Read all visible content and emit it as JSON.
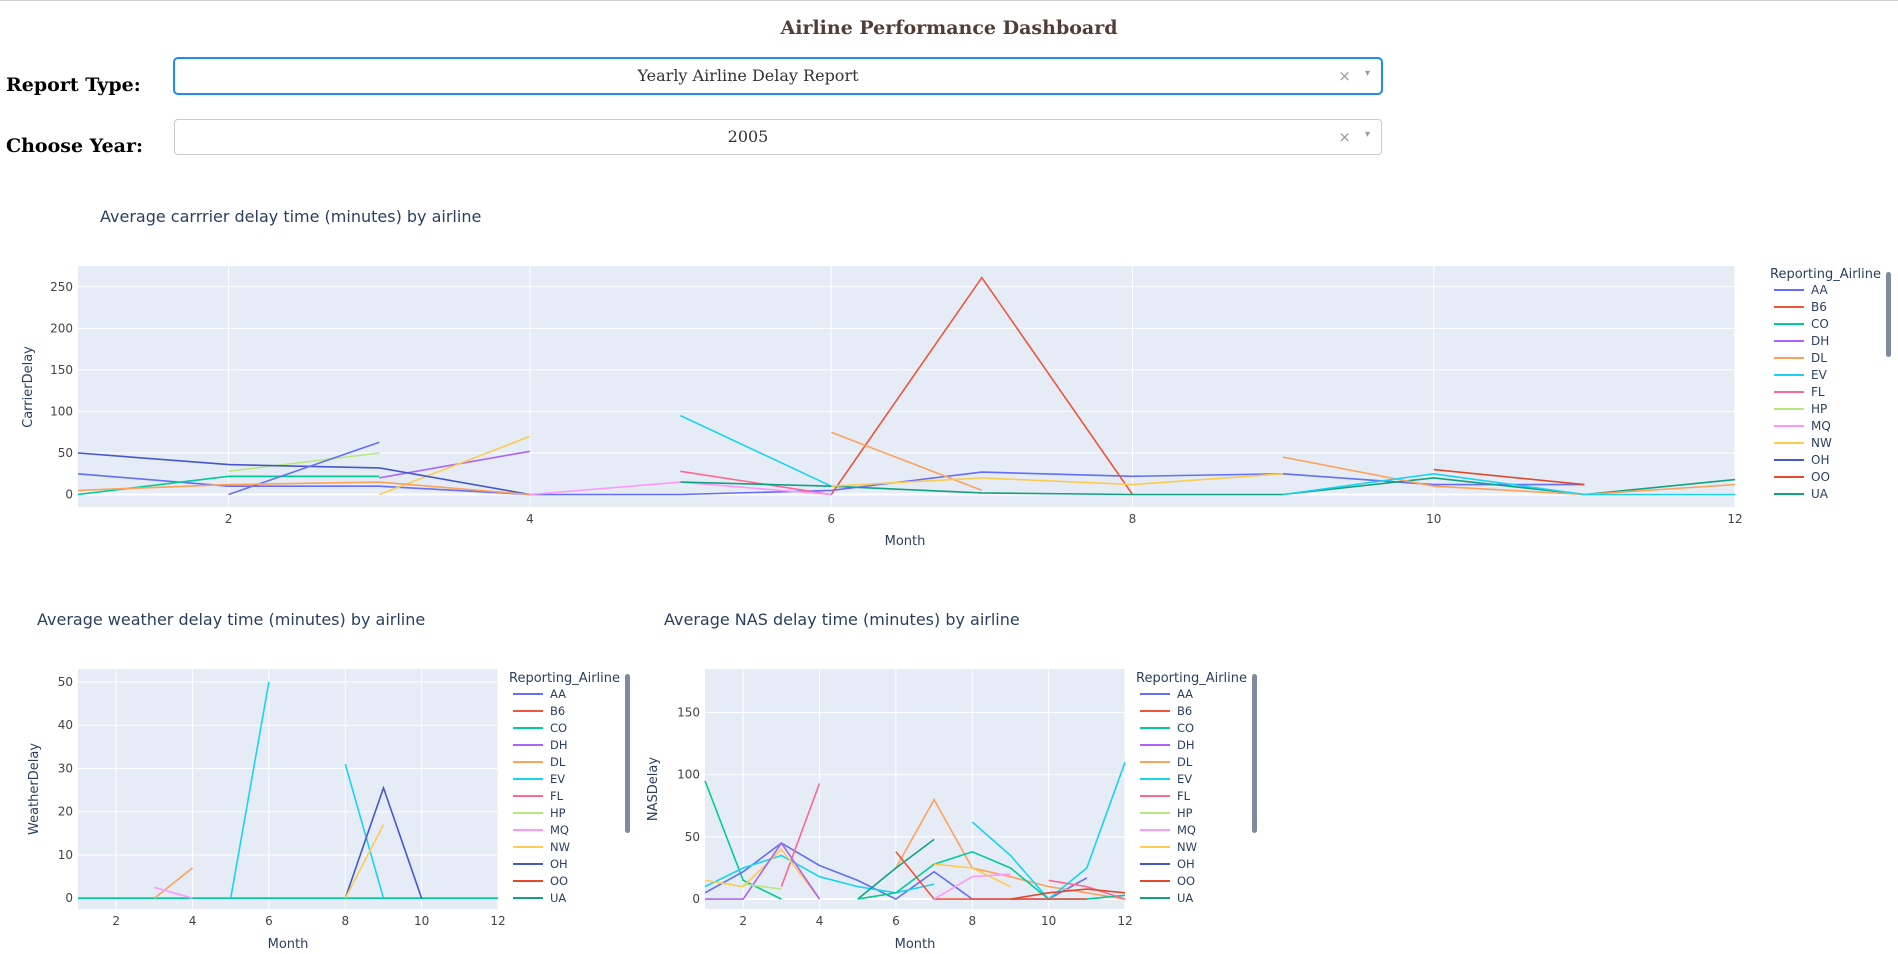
{
  "page_title": "Airline Performance Dashboard",
  "controls": {
    "report_type": {
      "label": "Report Type:",
      "value": "Yearly Airline Delay Report",
      "clear_icon": "×",
      "arrow_icon": "▾"
    },
    "year": {
      "label": "Choose Year:",
      "value": "2005",
      "clear_icon": "×",
      "arrow_icon": "▾"
    }
  },
  "legend_title": "Reporting_Airline",
  "airlines": [
    "AA",
    "B6",
    "CO",
    "DH",
    "DL",
    "EV",
    "FL",
    "HP",
    "MQ",
    "NW",
    "OH",
    "OO",
    "UA"
  ],
  "colors": {
    "AA": "#636efa",
    "B6": "#ef553b",
    "CO": "#00cc96",
    "DH": "#ab63fa",
    "DL": "#ffa15a",
    "EV": "#19d3f3",
    "FL": "#ff6692",
    "HP": "#b6e880",
    "MQ": "#ff97ff",
    "NW": "#fecb52",
    "OH": "#4458cc",
    "OO": "#e04a2a",
    "UA": "#10a37f"
  },
  "chart_data": [
    {
      "type": "line",
      "title": "Average carrrier delay time (minutes) by airline",
      "xlabel": "Month",
      "ylabel": "CarrierDelay",
      "xlim": [
        1,
        12
      ],
      "ylim": [
        -15,
        275
      ],
      "x_ticks": [
        2,
        4,
        6,
        8,
        10,
        12
      ],
      "y_ticks": [
        0,
        50,
        100,
        150,
        200,
        250
      ],
      "series": [
        {
          "name": "AA",
          "points": [
            [
              1,
              25
            ],
            [
              2,
              10
            ],
            [
              3,
              10
            ],
            [
              4,
              0
            ],
            [
              5,
              0
            ],
            [
              6,
              5
            ],
            [
              7,
              27
            ],
            [
              8,
              22
            ],
            [
              9,
              25
            ],
            [
              10,
              12
            ],
            [
              11,
              12
            ]
          ]
        },
        {
          "name": "B6",
          "points": [
            [
              6,
              0
            ],
            [
              7,
              261
            ],
            [
              8,
              0
            ]
          ]
        },
        {
          "name": "CO",
          "points": [
            [
              1,
              0
            ],
            [
              2,
              22
            ],
            [
              3,
              22
            ]
          ]
        },
        {
          "name": "DH",
          "points": [
            [
              3,
              20
            ],
            [
              4,
              52
            ]
          ]
        },
        {
          "name": "DL",
          "points": [
            [
              6,
              75
            ],
            [
              7,
              5
            ]
          ]
        },
        {
          "name": "EV",
          "points": [
            [
              5,
              95
            ],
            [
              6,
              10
            ]
          ]
        },
        {
          "name": "FL",
          "points": [
            [
              5,
              28
            ],
            [
              6,
              0
            ]
          ]
        },
        {
          "name": "HP",
          "points": [
            [
              2,
              28
            ],
            [
              3,
              50
            ]
          ]
        },
        {
          "name": "MQ",
          "points": [
            [
              4,
              0
            ],
            [
              5,
              15
            ],
            [
              6,
              0
            ]
          ]
        },
        {
          "name": "NW",
          "points": [
            [
              3,
              0
            ],
            [
              4,
              70
            ]
          ]
        },
        {
          "name": "OH",
          "points": [
            [
              1,
              50
            ],
            [
              2,
              36
            ],
            [
              3,
              32
            ],
            [
              4,
              0
            ]
          ]
        },
        {
          "name": "OO",
          "points": [
            [
              10,
              30
            ],
            [
              11,
              12
            ]
          ]
        },
        {
          "name": "UA",
          "points": [
            [
              5,
              15
            ],
            [
              6,
              10
            ],
            [
              7,
              2
            ],
            [
              8,
              0
            ],
            [
              9,
              0
            ],
            [
              10,
              20
            ],
            [
              11,
              0
            ],
            [
              12,
              18
            ]
          ]
        },
        {
          "name": "DL",
          "points": [
            [
              9,
              45
            ],
            [
              10,
              10
            ],
            [
              11,
              0
            ],
            [
              12,
              12
            ]
          ]
        },
        {
          "name": "EV",
          "points": [
            [
              9,
              0
            ],
            [
              10,
              25
            ],
            [
              11,
              0
            ],
            [
              12,
              0
            ]
          ]
        },
        {
          "name": "NW",
          "points": [
            [
              6,
              10
            ],
            [
              7,
              20
            ],
            [
              8,
              12
            ],
            [
              9,
              25
            ]
          ]
        },
        {
          "name": "AA",
          "points": [
            [
              2,
              0
            ],
            [
              3,
              63
            ]
          ]
        },
        {
          "name": "DL",
          "points": [
            [
              1,
              5
            ],
            [
              2,
              12
            ],
            [
              3,
              15
            ],
            [
              4,
              0
            ]
          ]
        }
      ]
    },
    {
      "type": "line",
      "title": "Average weather delay time (minutes) by airline",
      "xlabel": "Month",
      "ylabel": "WeatherDelay",
      "xlim": [
        1,
        12
      ],
      "ylim": [
        -2.5,
        53
      ],
      "x_ticks": [
        2,
        4,
        6,
        8,
        10,
        12
      ],
      "y_ticks": [
        0,
        10,
        20,
        30,
        40,
        50
      ],
      "series": [
        {
          "name": "AA",
          "points": [
            [
              1,
              0
            ],
            [
              12,
              0
            ]
          ]
        },
        {
          "name": "CO",
          "points": [
            [
              1,
              0
            ],
            [
              12,
              0
            ]
          ]
        },
        {
          "name": "EV",
          "points": [
            [
              5,
              0
            ],
            [
              6,
              50
            ]
          ]
        },
        {
          "name": "EV",
          "points": [
            [
              8,
              31
            ],
            [
              9,
              0
            ]
          ]
        },
        {
          "name": "OH",
          "points": [
            [
              8,
              0
            ],
            [
              9,
              25.5
            ],
            [
              10,
              0
            ]
          ]
        },
        {
          "name": "NW",
          "points": [
            [
              8,
              0
            ],
            [
              9,
              17
            ]
          ]
        },
        {
          "name": "DL",
          "points": [
            [
              3,
              0
            ],
            [
              4,
              7
            ]
          ]
        },
        {
          "name": "MQ",
          "points": [
            [
              3,
              2.5
            ],
            [
              4,
              0
            ]
          ]
        }
      ]
    },
    {
      "type": "line",
      "title": "Average NAS delay time (minutes) by airline",
      "xlabel": "Month",
      "ylabel": "NASDelay",
      "xlim": [
        1,
        12
      ],
      "ylim": [
        -8,
        185
      ],
      "x_ticks": [
        2,
        4,
        6,
        8,
        10,
        12
      ],
      "y_ticks": [
        0,
        50,
        100,
        150
      ],
      "series": [
        {
          "name": "CO",
          "points": [
            [
              1,
              95
            ],
            [
              2,
              15
            ],
            [
              3,
              0
            ]
          ]
        },
        {
          "name": "AA",
          "points": [
            [
              1,
              5
            ],
            [
              2,
              22
            ],
            [
              3,
              45
            ],
            [
              4,
              27
            ],
            [
              5,
              15
            ],
            [
              6,
              0
            ],
            [
              7,
              22
            ],
            [
              8,
              0
            ],
            [
              9,
              0
            ],
            [
              10,
              0
            ],
            [
              11,
              17
            ]
          ]
        },
        {
          "name": "FL",
          "points": [
            [
              3,
              10
            ],
            [
              4,
              93
            ]
          ]
        },
        {
          "name": "EV",
          "points": [
            [
              1,
              10
            ],
            [
              2,
              25
            ],
            [
              3,
              35
            ],
            [
              4,
              18
            ],
            [
              5,
              10
            ],
            [
              6,
              5
            ],
            [
              7,
              12
            ]
          ]
        },
        {
          "name": "DL",
          "points": [
            [
              6,
              25
            ],
            [
              7,
              80
            ],
            [
              8,
              25
            ],
            [
              9,
              18
            ],
            [
              10,
              10
            ],
            [
              11,
              5
            ],
            [
              12,
              0
            ]
          ]
        },
        {
          "name": "UA",
          "points": [
            [
              5,
              0
            ],
            [
              6,
              25
            ],
            [
              7,
              48
            ]
          ]
        },
        {
          "name": "EV",
          "points": [
            [
              8,
              62
            ],
            [
              9,
              35
            ],
            [
              10,
              0
            ],
            [
              11,
              25
            ],
            [
              12,
              110
            ]
          ]
        },
        {
          "name": "CO",
          "points": [
            [
              5,
              0
            ],
            [
              6,
              5
            ],
            [
              7,
              28
            ],
            [
              8,
              38
            ],
            [
              9,
              25
            ],
            [
              10,
              0
            ],
            [
              11,
              0
            ],
            [
              12,
              3
            ]
          ]
        },
        {
          "name": "B6",
          "points": [
            [
              6,
              38
            ],
            [
              7,
              0
            ],
            [
              8,
              0
            ],
            [
              9,
              0
            ],
            [
              10,
              0
            ],
            [
              11,
              0
            ]
          ]
        },
        {
          "name": "NW",
          "points": [
            [
              1,
              15
            ],
            [
              2,
              10
            ],
            [
              3,
              40
            ],
            [
              4,
              0
            ]
          ]
        },
        {
          "name": "NW",
          "points": [
            [
              7,
              28
            ],
            [
              8,
              25
            ],
            [
              9,
              10
            ]
          ]
        },
        {
          "name": "MQ",
          "points": [
            [
              7,
              0
            ],
            [
              8,
              18
            ],
            [
              9,
              20
            ]
          ]
        },
        {
          "name": "DH",
          "points": [
            [
              1,
              0
            ],
            [
              2,
              0
            ],
            [
              3,
              45
            ],
            [
              4,
              0
            ]
          ]
        },
        {
          "name": "HP",
          "points": [
            [
              2,
              12
            ],
            [
              3,
              8
            ]
          ]
        },
        {
          "name": "FL",
          "points": [
            [
              10,
              15
            ],
            [
              11,
              10
            ],
            [
              12,
              0
            ]
          ]
        },
        {
          "name": "OO",
          "points": [
            [
              9,
              0
            ],
            [
              10,
              5
            ],
            [
              11,
              8
            ],
            [
              12,
              5
            ]
          ]
        }
      ]
    }
  ]
}
